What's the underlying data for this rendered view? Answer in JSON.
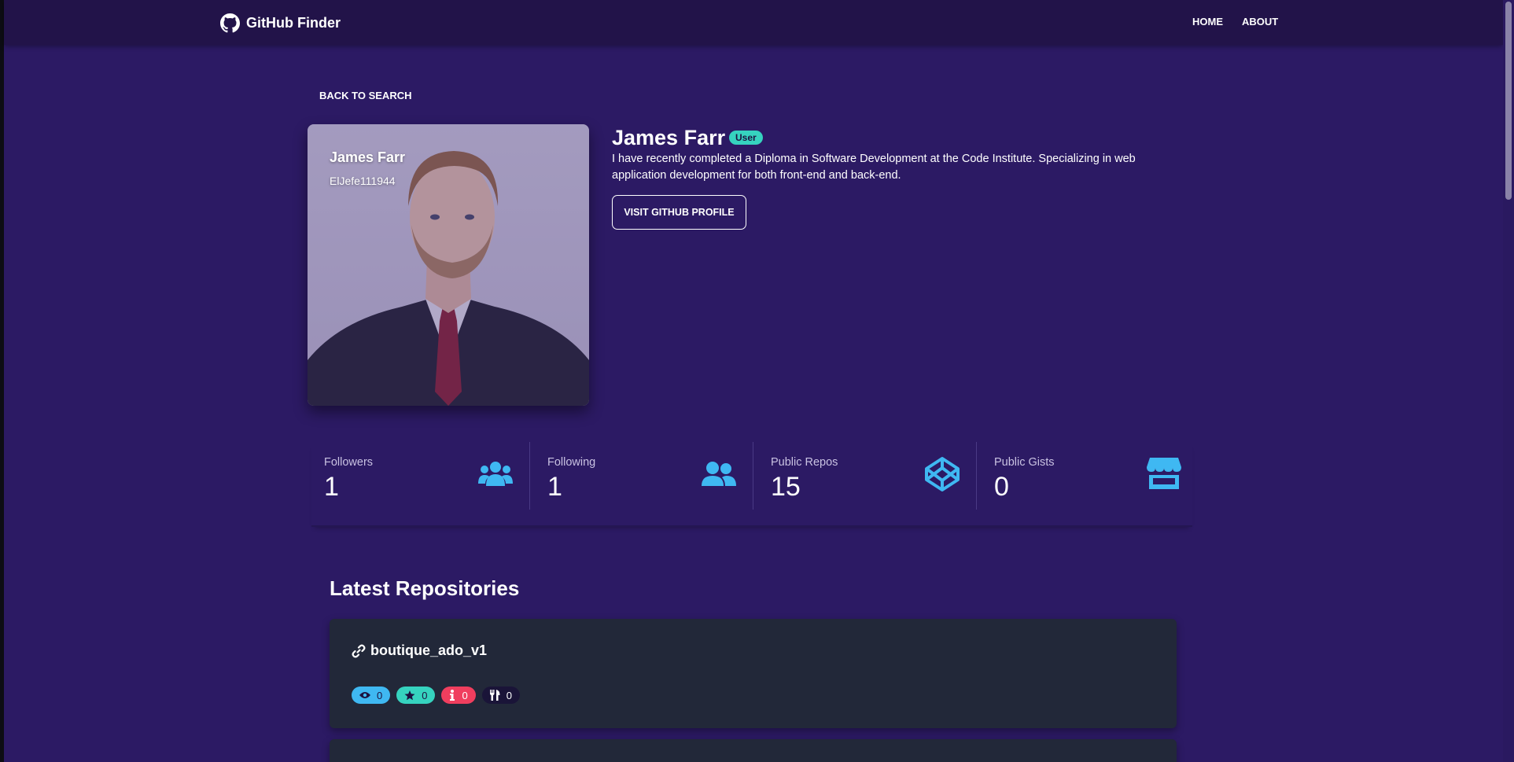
{
  "navbar": {
    "brand": "GitHub Finder",
    "links": [
      "HOME",
      "ABOUT"
    ]
  },
  "back_link": "BACK TO SEARCH",
  "profile": {
    "name": "James Farr",
    "login": "ElJefe111944",
    "type_badge": "User",
    "bio": "I have recently completed a Diploma in Software Development at the Code Institute. Specializing in web application development for both front-end and back-end.",
    "profile_button": "VISIT GITHUB PROFILE"
  },
  "stats": [
    {
      "label": "Followers",
      "value": "1",
      "icon": "users-icon"
    },
    {
      "label": "Following",
      "value": "1",
      "icon": "user-friends-icon"
    },
    {
      "label": "Public Repos",
      "value": "15",
      "icon": "codepen-icon"
    },
    {
      "label": "Public Gists",
      "value": "0",
      "icon": "store-icon"
    }
  ],
  "repos": {
    "title": "Latest Repositories",
    "items": [
      {
        "name": "boutique_ado_v1",
        "watchers": "0",
        "stars": "0",
        "issues": "0",
        "forks": "0"
      }
    ]
  },
  "colors": {
    "background": "#2c1a64",
    "navbar": "#221349",
    "accent_blue": "#3fb8f2",
    "accent_teal": "#36d3bf",
    "accent_red": "#f03e5e",
    "card": "#222839"
  }
}
